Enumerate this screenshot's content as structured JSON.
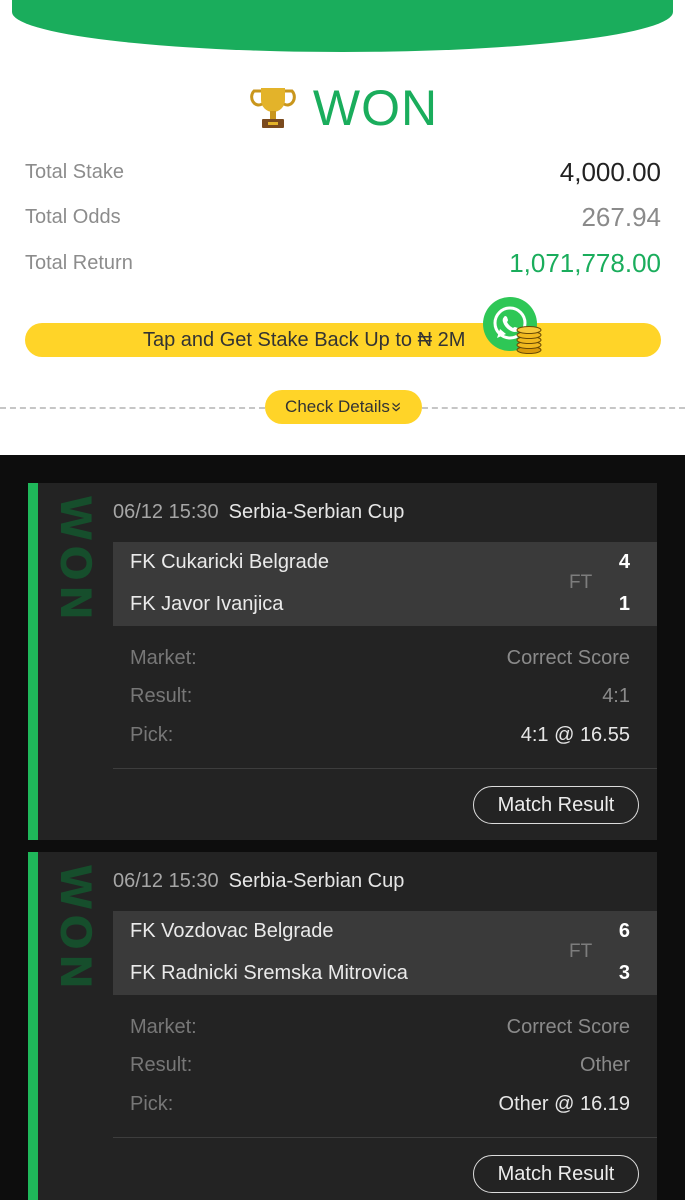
{
  "summary": {
    "status": "WON",
    "rows": {
      "stake": {
        "label": "Total Stake",
        "value": "4,000.00"
      },
      "odds": {
        "label": "Total Odds",
        "value": "267.94"
      },
      "return": {
        "label": "Total Return",
        "value": "1,071,778.00"
      }
    },
    "promo": "Tap and Get Stake Back Up to ₦ 2M",
    "check_details": "Check Details",
    "check_details_icon": "»"
  },
  "colors": {
    "accent_green": "#1aad5c",
    "promo_yellow": "#ffd428"
  },
  "matches": [
    {
      "stamp": "WON",
      "time": "06/12 15:30",
      "league": "Serbia-Serbian Cup",
      "home": "FK Cukaricki Belgrade",
      "away": "FK Javor Ivanjica",
      "home_score": "4",
      "away_score": "1",
      "status": "FT",
      "market_label": "Market:",
      "market": "Correct Score",
      "result_label": "Result:",
      "result": "4:1",
      "pick_label": "Pick:",
      "pick": "4:1 @ 16.55",
      "button": "Match Result"
    },
    {
      "stamp": "WON",
      "time": "06/12 15:30",
      "league": "Serbia-Serbian Cup",
      "home": "FK Vozdovac Belgrade",
      "away": "FK Radnicki Sremska Mitrovica",
      "home_score": "6",
      "away_score": "3",
      "status": "FT",
      "market_label": "Market:",
      "market": "Correct Score",
      "result_label": "Result:",
      "result": "Other",
      "pick_label": "Pick:",
      "pick": "Other @ 16.19",
      "button": "Match Result"
    }
  ]
}
